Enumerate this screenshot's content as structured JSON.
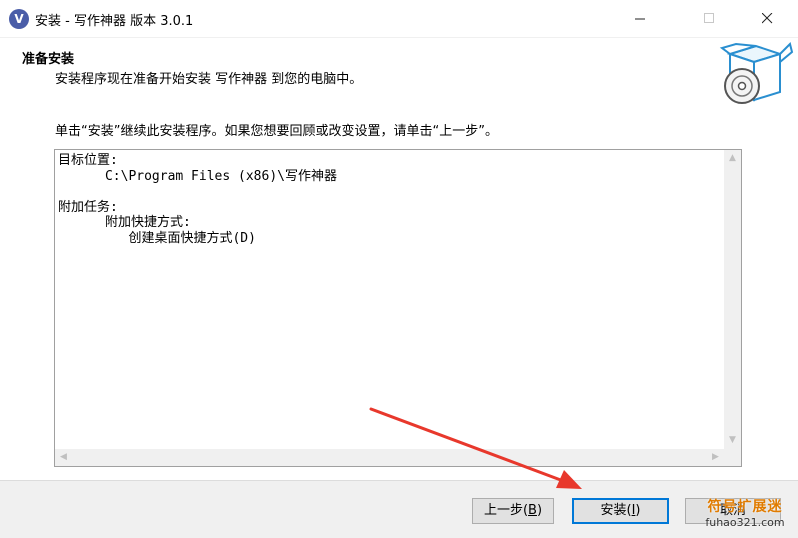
{
  "window": {
    "icon_letter": "V",
    "title": "安装 - 写作神器 版本 3.0.1"
  },
  "header": {
    "title": "准备安装",
    "subtitle": "安装程序现在准备开始安装 写作神器 到您的电脑中。"
  },
  "instruction": "单击“安装”继续此安装程序。如果您想要回顾或改变设置，请单击“上一步”。",
  "memo": {
    "lines": [
      "目标位置:",
      "      C:\\Program Files (x86)\\写作神器",
      "",
      "附加任务:",
      "      附加快捷方式:",
      "         创建桌面快捷方式(D)"
    ]
  },
  "buttons": {
    "back": {
      "label": "上一步(",
      "key": "B",
      "suffix": ")"
    },
    "install": {
      "label": "安装(",
      "key": "I",
      "suffix": ")"
    },
    "cancel": {
      "label": "取消"
    }
  },
  "watermark": {
    "line1": "符号扩展迷",
    "line2": "fuhao321.com"
  },
  "colors": {
    "accent": "#0078d7",
    "annotation_arrow": "#e8382c",
    "footer_bg": "#f0f0f0"
  }
}
